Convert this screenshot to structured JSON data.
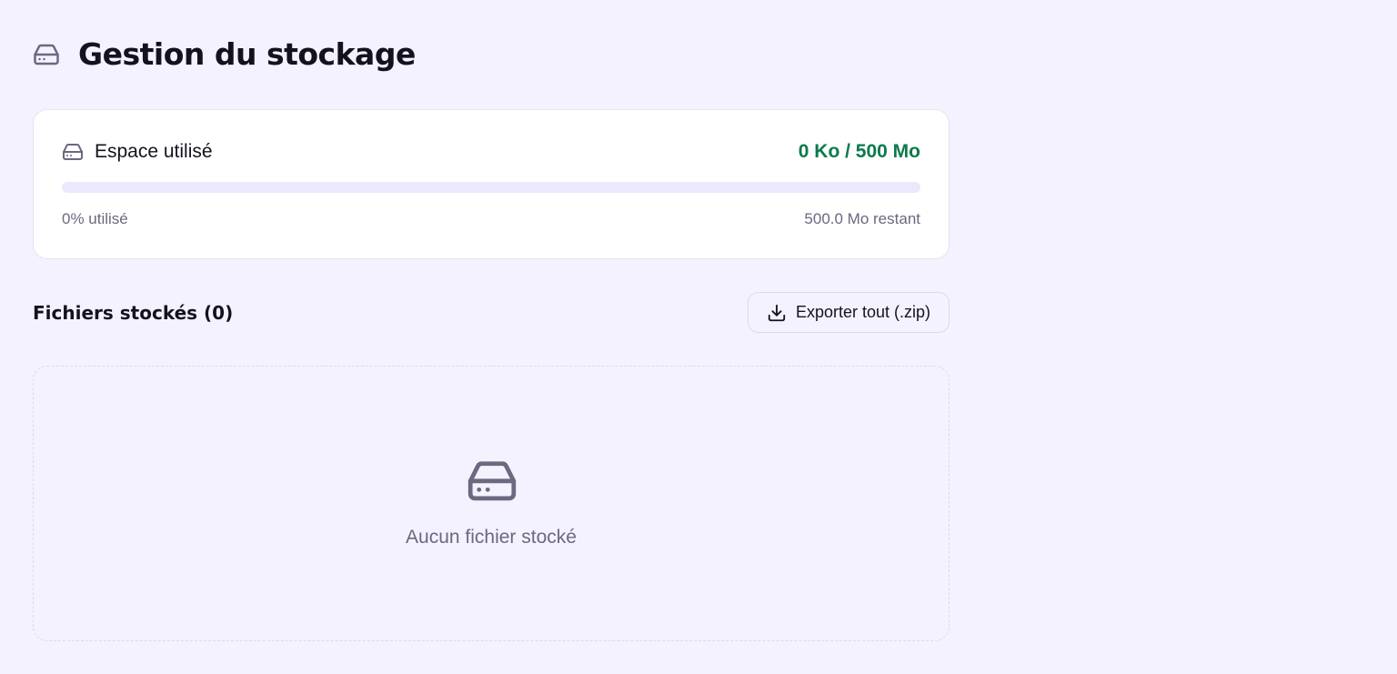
{
  "header": {
    "title": "Gestion du stockage",
    "icon": "hard-drive-icon"
  },
  "usage": {
    "label": "Espace utilisé",
    "icon": "hard-drive-icon",
    "value": "0 Ko / 500 Mo",
    "used_percent": 0,
    "used_text": "0% utilisé",
    "remaining_text": "500.0 Mo restant",
    "accent_color": "#0b7a4b"
  },
  "files": {
    "title": "Fichiers stockés (0)",
    "export_label": "Exporter tout (.zip)",
    "export_icon": "download-icon",
    "empty_icon": "hard-drive-icon",
    "empty_text": "Aucun fichier stocké"
  },
  "colors": {
    "background": "#f4f2fe",
    "card": "#ffffff",
    "text_primary": "#14121f",
    "text_muted": "#6b6880",
    "progress_track": "#ebe8fd"
  }
}
